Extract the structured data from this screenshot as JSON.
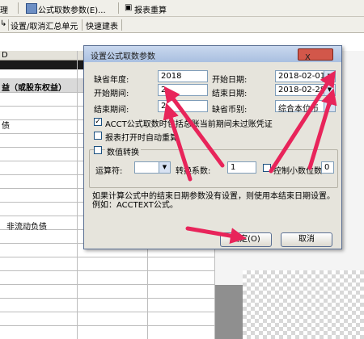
{
  "toolbar1": {
    "item1": "理",
    "item2": "公式取数参数(E)...",
    "item3": "报表重算"
  },
  "toolbar2": {
    "item1": "设置/取消汇总单元",
    "item2": "快速建表"
  },
  "sheet": {
    "col_header": "D",
    "header_cell": "益（或股东权益）",
    "row_text1": "债",
    "row_text2": "非流动负债"
  },
  "dialog": {
    "title": "设置公式取数参数",
    "close_label": "X",
    "default_year_label": "缺省年度:",
    "default_year_value": "2018",
    "start_date_label": "开始日期:",
    "start_date_value": "2018-02-01",
    "start_period_label": "开始期间:",
    "start_period_value": "2",
    "end_date_label": "结束日期:",
    "end_date_value": "2018-02-28",
    "end_period_label": "结束期间:",
    "end_period_value": "2",
    "currency_label": "缺省币别:",
    "currency_value": "综合本位币",
    "acct_checkbox_label": "ACCT公式取数时包括总账当前期间未过账凭证",
    "recalc_checkbox_label": "报表打开时自动重算",
    "convert_group_label": "数值转换",
    "operator_label": "运算符:",
    "coefficient_label": "转换系数:",
    "coefficient_value": "1",
    "decimal_label": "控制小数位数:",
    "decimal_value": "0",
    "note": "如果计算公式中的结束日期参数没有设置，则使用本结束日期设置。例如：ACCTEXT公式。",
    "ok_label": "确定(O)",
    "cancel_label": "取消"
  },
  "colors": {
    "arrow": "#e8245a",
    "dialog_title": "#a9bfe0",
    "close_button": "#d2574a"
  }
}
